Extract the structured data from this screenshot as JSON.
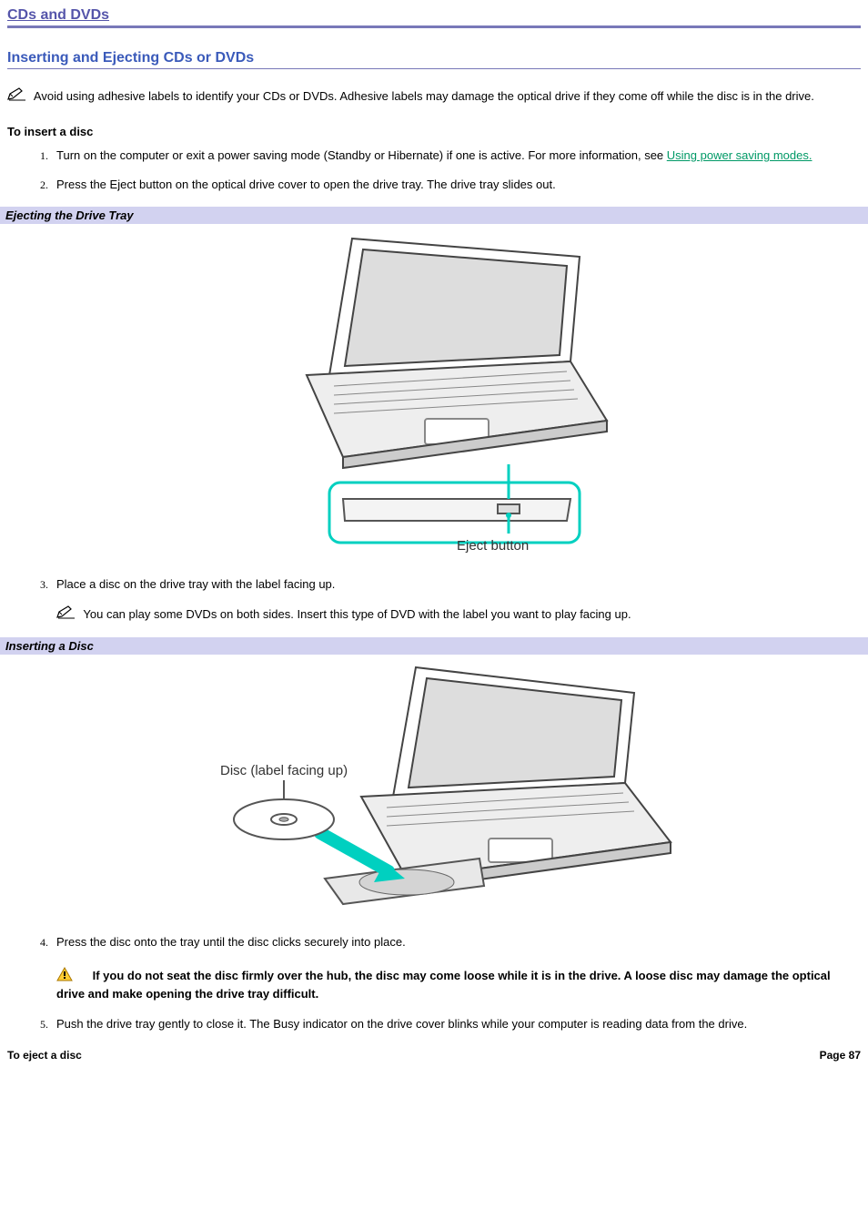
{
  "section_title": "CDs and DVDs",
  "sub_title": "Inserting and Ejecting CDs or DVDs",
  "note_top": "Avoid using adhesive labels to identify your CDs or DVDs. Adhesive labels may damage the optical drive if they come off while the disc is in the drive.",
  "insert_heading": "To insert a disc",
  "steps": {
    "s1_a": "Turn on the computer or exit a power saving mode (Standby or Hibernate) if one is active. For more information, see ",
    "s1_link": "Using power saving modes.",
    "s2": "Press the Eject button on the optical drive cover to open the drive tray. The drive tray slides out.",
    "s3": "Place a disc on the drive tray with the label facing up.",
    "s3_note": "You can play some DVDs on both sides. Insert this type of DVD with the label you want to play facing up.",
    "s4": "Press the disc onto the tray until the disc clicks securely into place.",
    "s4_warn": "If you do not seat the disc firmly over the hub, the disc may come loose while it is in the drive. A loose disc may damage the optical drive and make opening the drive tray difficult.",
    "s5": "Push the drive tray gently to close it. The Busy indicator on the drive cover blinks while your computer is reading data from the drive."
  },
  "caption1": "Ejecting the Drive Tray",
  "caption2": "Inserting a Disc",
  "fig1": {
    "eject_label": "Eject button"
  },
  "fig2": {
    "disc_label": "Disc (label facing up)"
  },
  "footer_left": "To eject a disc",
  "footer_right": "Page 87"
}
